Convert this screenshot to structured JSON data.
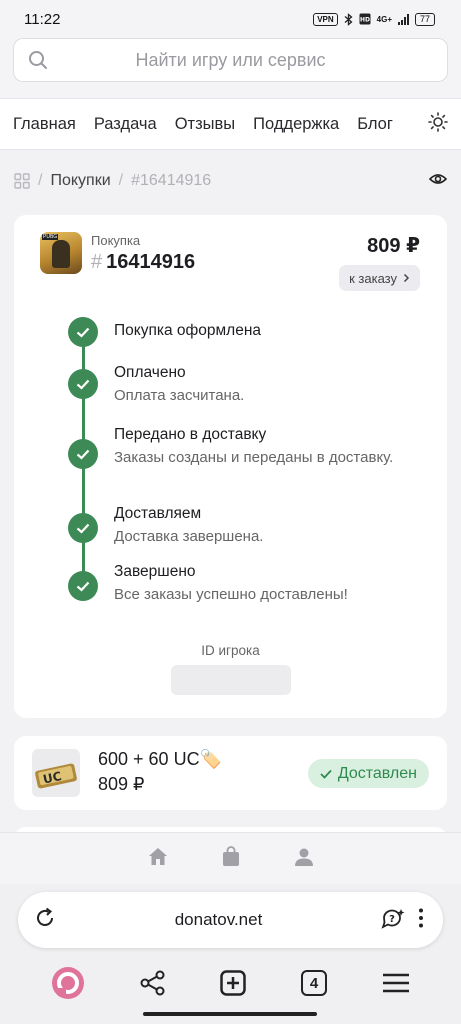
{
  "status_bar": {
    "time": "11:22",
    "vpn": "VPN",
    "network": "4G+",
    "battery": "77"
  },
  "search": {
    "placeholder": "Найти игру или сервис",
    "icon": "search-icon"
  },
  "nav": {
    "items": [
      "Главная",
      "Раздача",
      "Отзывы",
      "Поддержка",
      "Блог"
    ],
    "theme_icon": "sun-icon"
  },
  "breadcrumb": {
    "root_icon": "grid-icon",
    "section": "Покупки",
    "current": "#16414916",
    "sep": "/"
  },
  "order": {
    "label": "Покупка",
    "hash": "#",
    "number": "16414916",
    "price": "809 ₽",
    "to_order_label": "к заказу",
    "steps": [
      {
        "title": "Покупка оформлена",
        "desc": ""
      },
      {
        "title": "Оплачено",
        "desc": "Оплата засчитана."
      },
      {
        "title": "Передано в доставку",
        "desc": "Заказы созданы и переданы в доставку."
      },
      {
        "title": "Доставляем",
        "desc": "Доставка завершена."
      },
      {
        "title": "Завершено",
        "desc": "Все заказы успешно доставлены!"
      }
    ],
    "player_id_label": "ID игрока",
    "player_id_value": ""
  },
  "item": {
    "name": "600 + 60 UC🏷️",
    "price": "809 ₽",
    "status": "Доставлен",
    "image_text": "UC"
  },
  "bottom_nav": {
    "icons": [
      "home-icon",
      "bag-icon",
      "user-icon"
    ]
  },
  "browser": {
    "url": "donatov.net",
    "tab_count": "4"
  },
  "colors": {
    "accent_green": "#3e8a57",
    "badge_bg": "#d9efdf"
  }
}
